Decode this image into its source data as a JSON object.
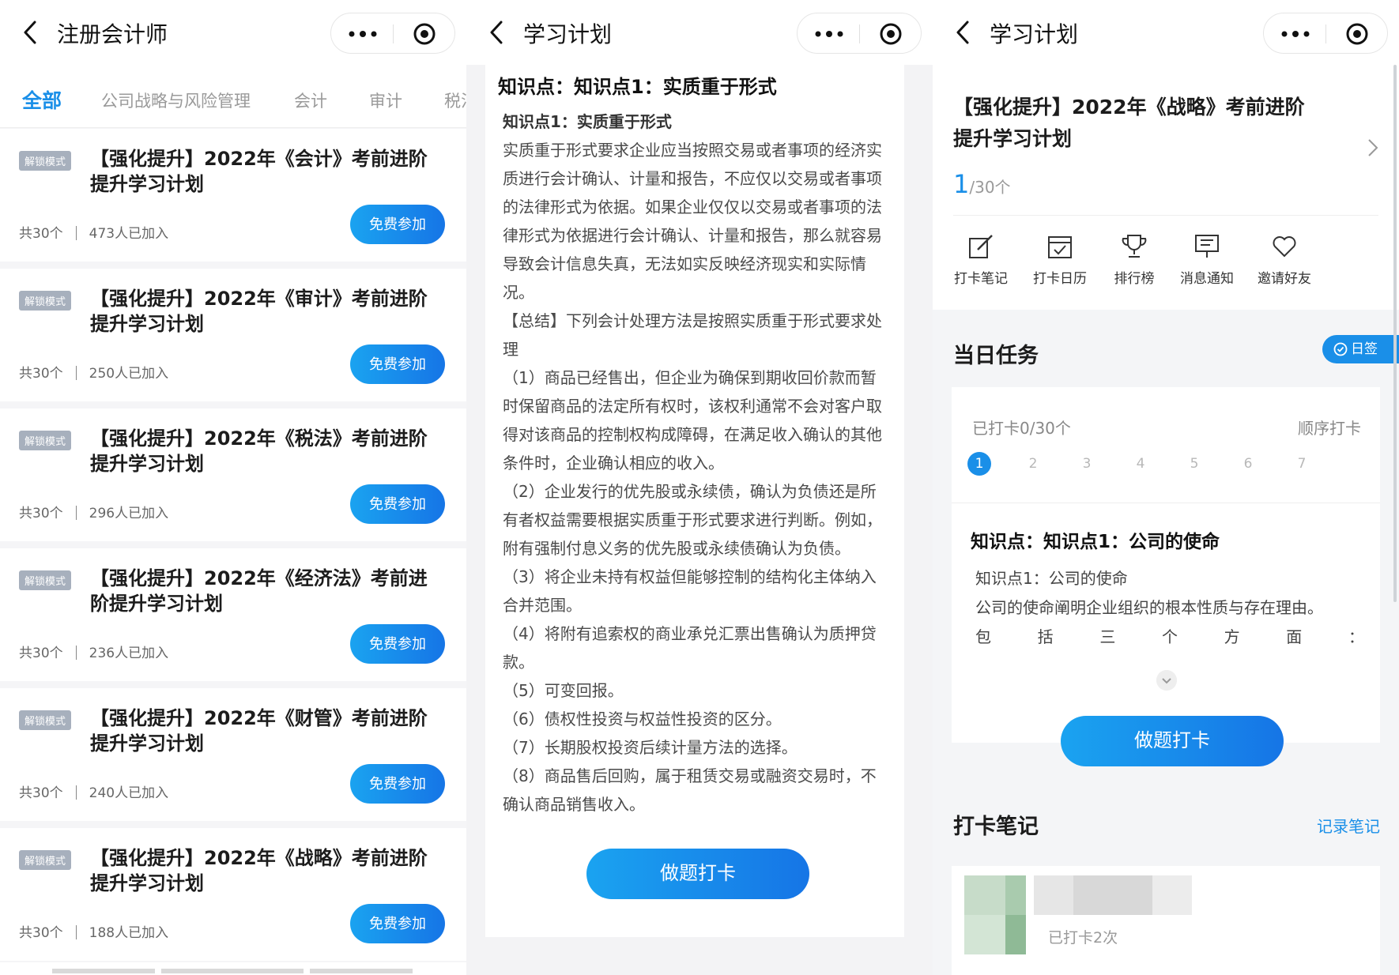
{
  "panel1": {
    "nav_title": "注册会计师",
    "tabs": [
      "全部",
      "公司战略与风险管理",
      "会计",
      "审计",
      "税法"
    ],
    "badge_label": "解锁模式",
    "join_label": "免费参加",
    "cards": [
      {
        "title": "【强化提升】2022年《会计》考前进阶提升学习计划",
        "count": "共30个",
        "joined": "473人已加入"
      },
      {
        "title": "【强化提升】2022年《审计》考前进阶提升学习计划",
        "count": "共30个",
        "joined": "250人已加入"
      },
      {
        "title": "【强化提升】2022年《税法》考前进阶提升学习计划",
        "count": "共30个",
        "joined": "296人已加入"
      },
      {
        "title": "【强化提升】2022年《经济法》考前进阶提升学习计划",
        "count": "共30个",
        "joined": "236人已加入"
      },
      {
        "title": "【强化提升】2022年《财管》考前进阶提升学习计划",
        "count": "共30个",
        "joined": "240人已加入"
      },
      {
        "title": "【强化提升】2022年《战略》考前进阶提升学习计划",
        "count": "共30个",
        "joined": "188人已加入"
      }
    ]
  },
  "panel2": {
    "nav_title": "学习计划",
    "heading": "知识点：知识点1：实质重于形式",
    "subheading": "知识点1：实质重于形式",
    "paragraphs": [
      "实质重于形式要求企业应当按照交易或者事项的经济实质进行会计确认、计量和报告，不应仅以交易或者事项的法律形式为依据。如果企业仅仅以交易或者事项的法律形式为依据进行会计确认、计量和报告，那么就容易导致会计信息失真，无法如实反映经济现实和实际情况。",
      "【总结】下列会计处理方法是按照实质重于形式要求处理",
      "（1）商品已经售出，但企业为确保到期收回价款而暂时保留商品的法定所有权时，该权利通常不会对客户取得对该商品的控制权构成障碍，在满足收入确认的其他条件时，企业确认相应的收入。",
      "（2）企业发行的优先股或永续债，确认为负债还是所有者权益需要根据实质重于形式要求进行判断。例如，附有强制付息义务的优先股或永续债确认为负债。",
      "（3）将企业未持有权益但能够控制的结构化主体纳入合并范围。",
      "（4）将附有追索权的商业承兑汇票出售确认为质押贷款。",
      "（5）可变回报。",
      "（6）债权性投资与权益性投资的区分。",
      "（7）长期股权投资后续计量方法的选择。",
      "（8）商品售后回购，属于租赁交易或融资交易时，不确认商品销售收入。"
    ],
    "button_label": "做题打卡"
  },
  "panel3": {
    "nav_title": "学习计划",
    "plan_title": "【强化提升】2022年《战略》考前进阶提升学习计划",
    "progress_current": "1",
    "progress_total": "/30个",
    "tools": [
      "打卡笔记",
      "打卡日历",
      "排行榜",
      "消息通知",
      "邀请好友"
    ],
    "daily_title": "当日任务",
    "sign_label": "日签",
    "checked_count": "已打卡0/30个",
    "order_label": "顺序打卡",
    "days": [
      "1",
      "2",
      "3",
      "4",
      "5",
      "6",
      "7"
    ],
    "kp_heading": "知识点：知识点1：公司的使命",
    "kp_sub": "知识点1：公司的使命",
    "kp_body": "公司的使命阐明企业组织的根本性质与存在理由。",
    "kp_spread": [
      "包",
      "括",
      "三",
      "个",
      "方",
      "面",
      "："
    ],
    "button_label": "做题打卡",
    "notes_title": "打卡笔记",
    "notes_link": "记录笔记",
    "note_count": "已打卡2次"
  },
  "colors": {
    "accent": "#1a8fe8",
    "badge": "#a7b0bd"
  },
  "icons": [
    "back-arrow-icon",
    "more-dots-icon",
    "target-circle-icon",
    "chevron-right-icon",
    "edit-note-icon",
    "calendar-check-icon",
    "trophy-icon",
    "message-board-icon",
    "heart-chat-icon",
    "check-circle-icon",
    "chevron-up-icon",
    "chevron-down-icon"
  ]
}
